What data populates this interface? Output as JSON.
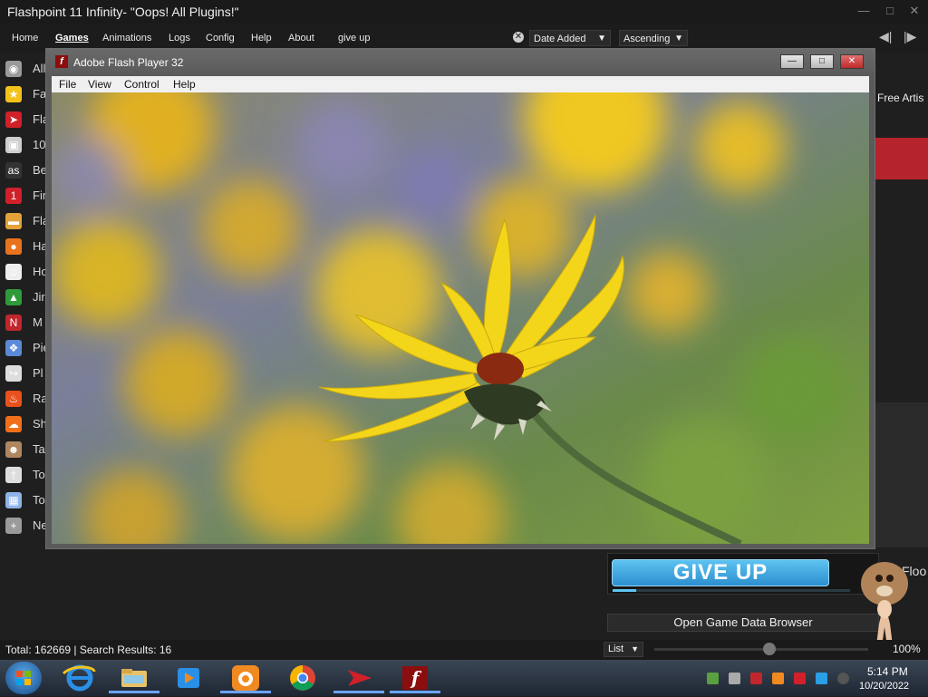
{
  "app": {
    "title": "Flashpoint 11 Infinity- \"Oops! All Plugins!\"",
    "window_controls": [
      "minimize-icon",
      "maximize-icon",
      "close-icon"
    ]
  },
  "nav": {
    "items": [
      "Home",
      "Games",
      "Animations",
      "Logs",
      "Config",
      "Help",
      "About"
    ],
    "active": "Games",
    "search_value": "give up",
    "sort_field": "Date Added",
    "sort_order": "Ascending"
  },
  "sidebar": {
    "items": [
      {
        "label": "All",
        "icon": "eye-icon",
        "color": "#9a9a9a"
      },
      {
        "label": "Fa",
        "icon": "star-icon",
        "color": "#f2c21b"
      },
      {
        "label": "Fla",
        "icon": "flashpoint-icon",
        "color": "#d0202a"
      },
      {
        "label": "10",
        "icon": "invader-icon",
        "color": "#cfcfcf"
      },
      {
        "label": "Be",
        "icon": "as-icon",
        "color": "#333333"
      },
      {
        "label": "Fir",
        "icon": "number-one-icon",
        "color": "#d0202a"
      },
      {
        "label": "Fla",
        "icon": "burger-icon",
        "color": "#e3a23a"
      },
      {
        "label": "Ha",
        "icon": "pumpkin-icon",
        "color": "#e8731c"
      },
      {
        "label": "Ho",
        "icon": "face-icon",
        "color": "#eeeeee"
      },
      {
        "label": "Jir",
        "icon": "tree-icon",
        "color": "#2f9a3a"
      },
      {
        "label": "M",
        "icon": "newgrounds-icon",
        "color": "#c0262c"
      },
      {
        "label": "Pie",
        "icon": "pixel-icon",
        "color": "#5a8ad8"
      },
      {
        "label": "Pl",
        "icon": "share-icon",
        "color": "#dddddd"
      },
      {
        "label": "Ra",
        "icon": "fire-icon",
        "color": "#e8501c"
      },
      {
        "label": "Sh",
        "icon": "soundcloud-icon",
        "color": "#f26f1a"
      },
      {
        "label": "Ta",
        "icon": "portrait-icon",
        "color": "#b08660"
      },
      {
        "label": "To",
        "icon": "figure-icon",
        "color": "#dddddd"
      },
      {
        "label": "To",
        "icon": "blocks-icon",
        "color": "#8fb3e8"
      },
      {
        "label": "Ne",
        "icon": "plus-icon",
        "color": "#9a9a9a"
      }
    ]
  },
  "right_panel": {
    "label": "Free Artis",
    "accent": "#b5242c"
  },
  "flash_window": {
    "title": "Adobe Flash Player 32",
    "menu": [
      "File",
      "View",
      "Control",
      "Help"
    ],
    "buttons": [
      "minimize-icon",
      "maximize-icon",
      "close-icon"
    ]
  },
  "game_panel": {
    "give_up_label": "GIVE UP",
    "progress": 0.1,
    "open_browser_label": "Open Game Data Browser",
    "partial_label": "Floo"
  },
  "status": {
    "text": "Total: 162669 | Search Results: 16",
    "view_mode": "List",
    "zoom": "100%",
    "zoom_value": 0.54
  },
  "taskbar": {
    "apps": [
      "internet-explorer-icon",
      "file-explorer-icon",
      "media-player-icon",
      "uc-browser-icon",
      "chrome-icon",
      "flashpoint-icon",
      "flash-player-icon"
    ],
    "time": "5:14 PM",
    "date": "10/20/2022"
  }
}
